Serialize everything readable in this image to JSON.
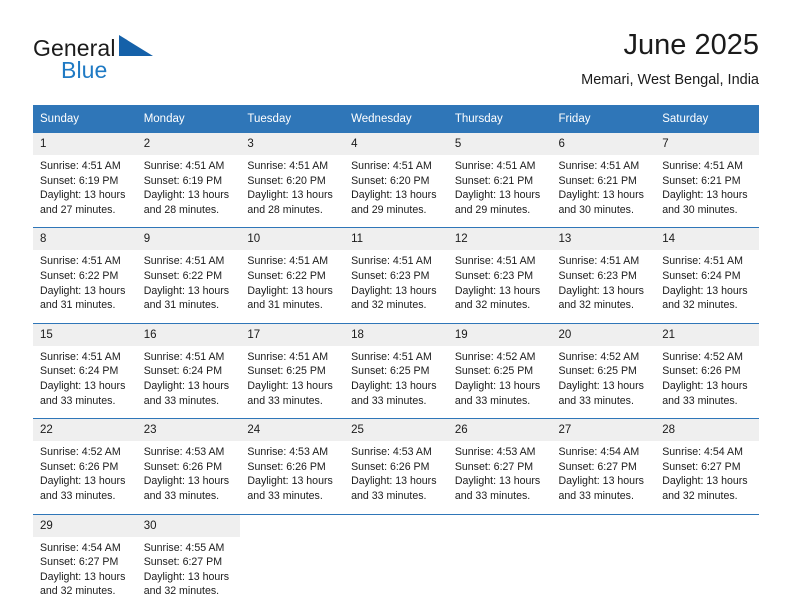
{
  "brand": {
    "name_part1": "General",
    "name_part2": "Blue",
    "logo_icon": "triangle-flag-icon"
  },
  "header": {
    "title": "June 2025",
    "subtitle": "Memari, West Bengal, India"
  },
  "colors": {
    "header_blue": "#2f76b8",
    "brand_blue": "#1f7ac4",
    "daynum_bg": "#efefef",
    "text": "#1b1b1b"
  },
  "calendar": {
    "weekday_headers": [
      "Sunday",
      "Monday",
      "Tuesday",
      "Wednesday",
      "Thursday",
      "Friday",
      "Saturday"
    ],
    "weeks": [
      [
        {
          "day": "1",
          "sunrise": "Sunrise: 4:51 AM",
          "sunset": "Sunset: 6:19 PM",
          "daylight1": "Daylight: 13 hours",
          "daylight2": "and 27 minutes."
        },
        {
          "day": "2",
          "sunrise": "Sunrise: 4:51 AM",
          "sunset": "Sunset: 6:19 PM",
          "daylight1": "Daylight: 13 hours",
          "daylight2": "and 28 minutes."
        },
        {
          "day": "3",
          "sunrise": "Sunrise: 4:51 AM",
          "sunset": "Sunset: 6:20 PM",
          "daylight1": "Daylight: 13 hours",
          "daylight2": "and 28 minutes."
        },
        {
          "day": "4",
          "sunrise": "Sunrise: 4:51 AM",
          "sunset": "Sunset: 6:20 PM",
          "daylight1": "Daylight: 13 hours",
          "daylight2": "and 29 minutes."
        },
        {
          "day": "5",
          "sunrise": "Sunrise: 4:51 AM",
          "sunset": "Sunset: 6:21 PM",
          "daylight1": "Daylight: 13 hours",
          "daylight2": "and 29 minutes."
        },
        {
          "day": "6",
          "sunrise": "Sunrise: 4:51 AM",
          "sunset": "Sunset: 6:21 PM",
          "daylight1": "Daylight: 13 hours",
          "daylight2": "and 30 minutes."
        },
        {
          "day": "7",
          "sunrise": "Sunrise: 4:51 AM",
          "sunset": "Sunset: 6:21 PM",
          "daylight1": "Daylight: 13 hours",
          "daylight2": "and 30 minutes."
        }
      ],
      [
        {
          "day": "8",
          "sunrise": "Sunrise: 4:51 AM",
          "sunset": "Sunset: 6:22 PM",
          "daylight1": "Daylight: 13 hours",
          "daylight2": "and 31 minutes."
        },
        {
          "day": "9",
          "sunrise": "Sunrise: 4:51 AM",
          "sunset": "Sunset: 6:22 PM",
          "daylight1": "Daylight: 13 hours",
          "daylight2": "and 31 minutes."
        },
        {
          "day": "10",
          "sunrise": "Sunrise: 4:51 AM",
          "sunset": "Sunset: 6:22 PM",
          "daylight1": "Daylight: 13 hours",
          "daylight2": "and 31 minutes."
        },
        {
          "day": "11",
          "sunrise": "Sunrise: 4:51 AM",
          "sunset": "Sunset: 6:23 PM",
          "daylight1": "Daylight: 13 hours",
          "daylight2": "and 32 minutes."
        },
        {
          "day": "12",
          "sunrise": "Sunrise: 4:51 AM",
          "sunset": "Sunset: 6:23 PM",
          "daylight1": "Daylight: 13 hours",
          "daylight2": "and 32 minutes."
        },
        {
          "day": "13",
          "sunrise": "Sunrise: 4:51 AM",
          "sunset": "Sunset: 6:23 PM",
          "daylight1": "Daylight: 13 hours",
          "daylight2": "and 32 minutes."
        },
        {
          "day": "14",
          "sunrise": "Sunrise: 4:51 AM",
          "sunset": "Sunset: 6:24 PM",
          "daylight1": "Daylight: 13 hours",
          "daylight2": "and 32 minutes."
        }
      ],
      [
        {
          "day": "15",
          "sunrise": "Sunrise: 4:51 AM",
          "sunset": "Sunset: 6:24 PM",
          "daylight1": "Daylight: 13 hours",
          "daylight2": "and 33 minutes."
        },
        {
          "day": "16",
          "sunrise": "Sunrise: 4:51 AM",
          "sunset": "Sunset: 6:24 PM",
          "daylight1": "Daylight: 13 hours",
          "daylight2": "and 33 minutes."
        },
        {
          "day": "17",
          "sunrise": "Sunrise: 4:51 AM",
          "sunset": "Sunset: 6:25 PM",
          "daylight1": "Daylight: 13 hours",
          "daylight2": "and 33 minutes."
        },
        {
          "day": "18",
          "sunrise": "Sunrise: 4:51 AM",
          "sunset": "Sunset: 6:25 PM",
          "daylight1": "Daylight: 13 hours",
          "daylight2": "and 33 minutes."
        },
        {
          "day": "19",
          "sunrise": "Sunrise: 4:52 AM",
          "sunset": "Sunset: 6:25 PM",
          "daylight1": "Daylight: 13 hours",
          "daylight2": "and 33 minutes."
        },
        {
          "day": "20",
          "sunrise": "Sunrise: 4:52 AM",
          "sunset": "Sunset: 6:25 PM",
          "daylight1": "Daylight: 13 hours",
          "daylight2": "and 33 minutes."
        },
        {
          "day": "21",
          "sunrise": "Sunrise: 4:52 AM",
          "sunset": "Sunset: 6:26 PM",
          "daylight1": "Daylight: 13 hours",
          "daylight2": "and 33 minutes."
        }
      ],
      [
        {
          "day": "22",
          "sunrise": "Sunrise: 4:52 AM",
          "sunset": "Sunset: 6:26 PM",
          "daylight1": "Daylight: 13 hours",
          "daylight2": "and 33 minutes."
        },
        {
          "day": "23",
          "sunrise": "Sunrise: 4:53 AM",
          "sunset": "Sunset: 6:26 PM",
          "daylight1": "Daylight: 13 hours",
          "daylight2": "and 33 minutes."
        },
        {
          "day": "24",
          "sunrise": "Sunrise: 4:53 AM",
          "sunset": "Sunset: 6:26 PM",
          "daylight1": "Daylight: 13 hours",
          "daylight2": "and 33 minutes."
        },
        {
          "day": "25",
          "sunrise": "Sunrise: 4:53 AM",
          "sunset": "Sunset: 6:26 PM",
          "daylight1": "Daylight: 13 hours",
          "daylight2": "and 33 minutes."
        },
        {
          "day": "26",
          "sunrise": "Sunrise: 4:53 AM",
          "sunset": "Sunset: 6:27 PM",
          "daylight1": "Daylight: 13 hours",
          "daylight2": "and 33 minutes."
        },
        {
          "day": "27",
          "sunrise": "Sunrise: 4:54 AM",
          "sunset": "Sunset: 6:27 PM",
          "daylight1": "Daylight: 13 hours",
          "daylight2": "and 33 minutes."
        },
        {
          "day": "28",
          "sunrise": "Sunrise: 4:54 AM",
          "sunset": "Sunset: 6:27 PM",
          "daylight1": "Daylight: 13 hours",
          "daylight2": "and 32 minutes."
        }
      ],
      [
        {
          "day": "29",
          "sunrise": "Sunrise: 4:54 AM",
          "sunset": "Sunset: 6:27 PM",
          "daylight1": "Daylight: 13 hours",
          "daylight2": "and 32 minutes."
        },
        {
          "day": "30",
          "sunrise": "Sunrise: 4:55 AM",
          "sunset": "Sunset: 6:27 PM",
          "daylight1": "Daylight: 13 hours",
          "daylight2": "and 32 minutes."
        },
        {
          "day": "",
          "sunrise": "",
          "sunset": "",
          "daylight1": "",
          "daylight2": ""
        },
        {
          "day": "",
          "sunrise": "",
          "sunset": "",
          "daylight1": "",
          "daylight2": ""
        },
        {
          "day": "",
          "sunrise": "",
          "sunset": "",
          "daylight1": "",
          "daylight2": ""
        },
        {
          "day": "",
          "sunrise": "",
          "sunset": "",
          "daylight1": "",
          "daylight2": ""
        },
        {
          "day": "",
          "sunrise": "",
          "sunset": "",
          "daylight1": "",
          "daylight2": ""
        }
      ]
    ]
  }
}
